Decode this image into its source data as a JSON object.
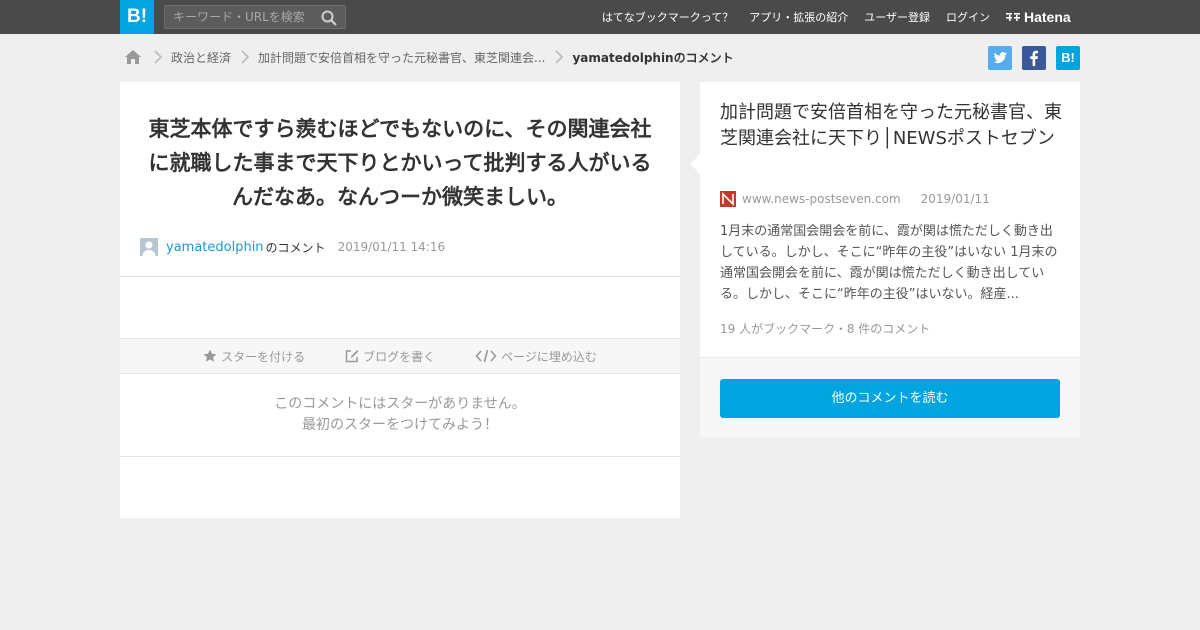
{
  "topbar": {
    "logo": "B!",
    "search_placeholder": "キーワード・URLを検索",
    "nav": [
      "はてなブックマークって？",
      "アプリ・拡張の紹介",
      "ユーザー登録",
      "ログイン"
    ],
    "hatena_label": "Hatena"
  },
  "breadcrumb": {
    "items": [
      "政治と経済",
      "加計問題で安倍首相を守った元秘書官、東芝関連会...",
      "yamatedolphinのコメント"
    ]
  },
  "share": {
    "hatena_label": "B!"
  },
  "comment": {
    "text": "東芝本体ですら羨むほどでもないのに、その関連会社に就職した事まで天下りとかいって批判する人がいるんだなあ。なんつーか微笑ましい。",
    "username": "yamatedolphin",
    "suffix": "のコメント",
    "time": "2019/01/11 14:16"
  },
  "actions": {
    "star": "スターを付ける",
    "blog": "ブログを書く",
    "embed": "ページに埋め込む"
  },
  "no_star": {
    "line1": "このコメントにはスターがありません。",
    "line2": "最初のスターをつけてみよう！"
  },
  "entry": {
    "title": "加計問題で安倍首相を守った元秘書官、東芝関連会社に天下り│NEWSポストセブン",
    "domain": "www.news-postseven.com",
    "date": "2019/01/11",
    "summary": "1月末の通常国会開会を前に、霞が関は慌ただしく動き出している。しかし、そこに“昨年の主役”はいない 1月末の通常国会開会を前に、霞が関は慌ただしく動き出している。しかし、そこに“昨年の主役”はいない。経産...",
    "counts": "19 人がブックマーク・8 件のコメント",
    "read_button": "他のコメントを読む"
  },
  "colors": {
    "topbar": "#4a4a4a",
    "brand": "#00a4de",
    "twitter": "#55acee",
    "facebook": "#3b5998",
    "link": "#1c9ad6"
  }
}
